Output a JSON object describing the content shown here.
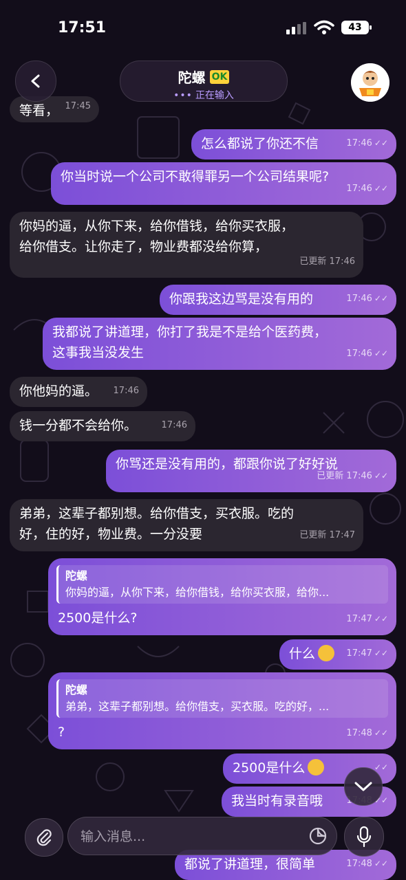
{
  "status_bar": {
    "time": "17:51",
    "battery": "43"
  },
  "header": {
    "title": "陀螺",
    "badge": "OK",
    "typing_dots": "•••",
    "status": "正在输入"
  },
  "messages": [
    {
      "side": "in",
      "text": "等看，",
      "time": "17:45",
      "edited": ""
    },
    {
      "side": "out",
      "text": "怎么都说了你还不信",
      "time": "17:46",
      "edited": ""
    },
    {
      "side": "out",
      "text": "你当时说一个公司不敢得罪另一个公司结果呢?",
      "time": "17:46",
      "edited": ""
    },
    {
      "side": "in",
      "text": "你妈的逼，从你下来，给你借钱，给你买衣服，\n给你借支。让你走了，物业费都没给你算，",
      "time": "17:46",
      "edited": "已更新"
    },
    {
      "side": "out",
      "text": "你跟我这边骂是没有用的",
      "time": "17:46",
      "edited": ""
    },
    {
      "side": "out",
      "text": "我都说了讲道理，你打了我是不是给个医药费，\n这事我当没发生",
      "time": "17:46",
      "edited": ""
    },
    {
      "side": "in",
      "text": "你他妈的逼。",
      "time": "17:46",
      "edited": ""
    },
    {
      "side": "in",
      "text": "钱一分都不会给你。",
      "time": "17:46",
      "edited": ""
    },
    {
      "side": "out",
      "text": "你骂还是没有用的，都跟你说了好好说",
      "time": "17:46",
      "edited": "已更新"
    },
    {
      "side": "in",
      "text": "弟弟，这辈子都别想。给你借支，买衣服。吃的\n好，住的好，物业费。一分没要",
      "time": "17:47",
      "edited": "已更新"
    },
    {
      "side": "out",
      "quote_name": "陀螺",
      "quote_text": "你妈的逼，从你下来，给你借钱，给你买衣服，给你...",
      "text": "2500是什么?",
      "time": "17:47",
      "edited": ""
    },
    {
      "side": "out",
      "text": "什么",
      "emoji": "thinking-face",
      "time": "17:47",
      "edited": ""
    },
    {
      "side": "out",
      "quote_name": "陀螺",
      "quote_text": "弟弟，这辈子都别想。给你借支，买衣服。吃的好，...",
      "text": "?",
      "time": "17:48",
      "edited": ""
    },
    {
      "side": "out",
      "text": "2500是什么",
      "emoji": "thinking-face",
      "time": "",
      "edited": ""
    },
    {
      "side": "out",
      "text": "我当时有录音哦",
      "time": "17:48",
      "edited": ""
    },
    {
      "side": "out",
      "text": "都说了讲道理，很简单",
      "time": "17:48",
      "edited": ""
    }
  ],
  "composer": {
    "placeholder": "输入消息..."
  },
  "icons": {
    "back": "chevron-left-icon",
    "scroll_down": "chevron-down-icon",
    "attach": "paperclip-icon",
    "sticker": "sticker-icon",
    "mic": "microphone-icon",
    "read": "double-check-icon"
  },
  "colors": {
    "outgoing_start": "#7c4fd8",
    "outgoing_end": "#a26ad8",
    "incoming": "#2b2630",
    "accent": "#b99cff"
  }
}
